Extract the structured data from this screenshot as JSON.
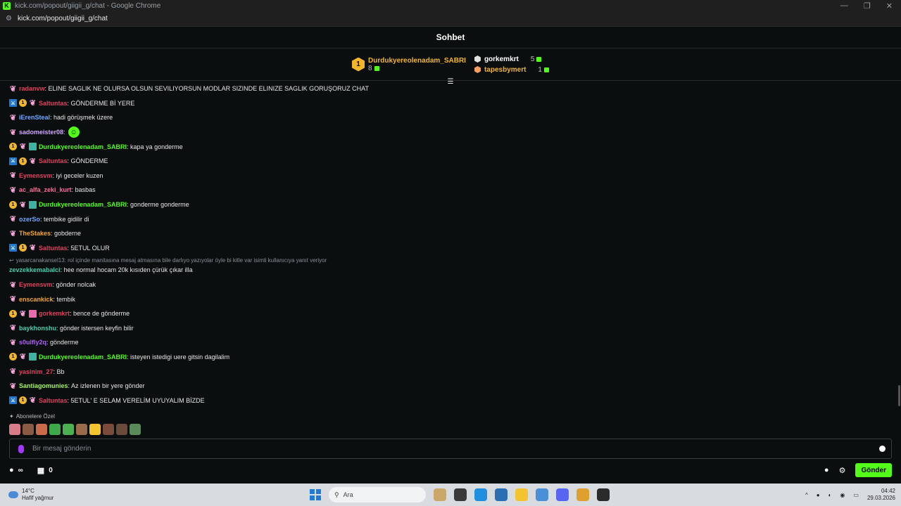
{
  "window": {
    "title": "kick.com/popout/giigii_g/chat - Google Chrome",
    "url": "kick.com/popout/giigii_g/chat",
    "controls": [
      "—",
      "❐",
      "✕"
    ]
  },
  "chat": {
    "header_title": "Sohbet",
    "leaderboard": {
      "first": {
        "rank": "1",
        "name": "Durdukyereolenadam_SABRI",
        "count": "8"
      },
      "others": [
        {
          "name": "gorkemkrt",
          "count": "5",
          "color": "#ffffff"
        },
        {
          "name": "tapesbymert",
          "count": "1",
          "color": "#f4b629"
        }
      ]
    },
    "messages": [
      {
        "badges": [
          "og"
        ],
        "user": "radanvw",
        "color": "#e3405f",
        "text": ": ELINE SAGLIK NE OLURSA OLSUN SEVILIYORSUN MODLAR SIZINDE ELINIZE SAGLIK GORUŞORUZ CHAT"
      },
      {
        "badges": [
          "mod",
          "sub",
          "og"
        ],
        "user": "Saltuntas",
        "color": "#e3405f",
        "text": ": GÖNDERME Bİ YERE"
      },
      {
        "badges": [
          "og"
        ],
        "user": "iErenSteal",
        "color": "#6fa8ff",
        "text": ": hadi görüşmek üzere"
      },
      {
        "badges": [
          "og"
        ],
        "user": "sadomeister08",
        "color": "#d0a6ff",
        "text": ":",
        "emote": true
      },
      {
        "badges": [
          "sub",
          "og",
          "gift"
        ],
        "user": "Durdukyereolenadam_SABRI",
        "color": "#53fc18",
        "text": ": kapa ya gonderme"
      },
      {
        "badges": [
          "mod",
          "sub",
          "og"
        ],
        "user": "Saltuntas",
        "color": "#e3405f",
        "text": ": GÖNDERME"
      },
      {
        "badges": [
          "og"
        ],
        "user": "Eymensvm",
        "color": "#e3405f",
        "text": ": iyi geceler kuzen"
      },
      {
        "badges": [
          "og"
        ],
        "user": "ac_alfa_zeki_kurt",
        "color": "#ff6b9a",
        "text": ": basbas"
      },
      {
        "badges": [
          "sub",
          "og",
          "gift"
        ],
        "user": "Durdukyereolenadam_SABRI",
        "color": "#53fc18",
        "text": ": gonderme gonderme"
      },
      {
        "badges": [
          "og"
        ],
        "user": "ozerSo",
        "color": "#6fa8ff",
        "text": ": tembike gidilir di"
      },
      {
        "badges": [
          "og"
        ],
        "user": "TheStakes",
        "color": "#f5a623",
        "text": ": gobderne"
      },
      {
        "badges": [
          "mod",
          "sub",
          "og"
        ],
        "user": "Saltuntas",
        "color": "#e3405f",
        "text": ": 5ETUL OLUR"
      },
      {
        "reply": "yasarcanakansel13: rol içinde manitasına mesaj atmasına bile darlıyo yazıyolar öyle bi kitle var isimli kullanıcıya yanıt veriyor",
        "badges": [],
        "user": "zevzekkemabalci",
        "color": "#3fd0b0",
        "text": ": hee normal hocam 20k kısıden çürük çıkar illa"
      },
      {
        "badges": [
          "og"
        ],
        "user": "Eymensvm",
        "color": "#e3405f",
        "text": ": gönder nolcak"
      },
      {
        "badges": [
          "og"
        ],
        "user": "enscankick",
        "color": "#f5a623",
        "text": ": tembik"
      },
      {
        "badges": [
          "sub",
          "og",
          "gifter"
        ],
        "user": "gorkemkrt",
        "color": "#e3405f",
        "text": ": bence de gönderme"
      },
      {
        "badges": [
          "og"
        ],
        "user": "baykhonshu",
        "color": "#3fd0b0",
        "text": ": gönder istersen keyfin bilir"
      },
      {
        "badges": [
          "og"
        ],
        "user": "s0ulfly2q",
        "color": "#b45cff",
        "text": ": gönderme"
      },
      {
        "badges": [
          "sub",
          "og",
          "gift"
        ],
        "user": "Durdukyereolenadam_SABRI",
        "color": "#53fc18",
        "text": ": isteyen istedigi uere gitsin dagilalim"
      },
      {
        "badges": [
          "og"
        ],
        "user": "yasinim_27",
        "color": "#e3405f",
        "text": ": Bb"
      },
      {
        "badges": [
          "og"
        ],
        "user": "Santiagomunies",
        "color": "#a6f25a",
        "text": ": Az izlenen bir yere gönder"
      },
      {
        "badges": [
          "mod",
          "sub",
          "og"
        ],
        "user": "Saltuntas",
        "color": "#e3405f",
        "text": ": 5ETUL' E SELAM VERELİM UYUYALIM BİZDE"
      }
    ],
    "quick_emotes_label": "Abonelere Özel",
    "quick_emote_colors": [
      "#d97c8a",
      "#8a5a44",
      "#c96a4a",
      "#3fa84a",
      "#4caf50",
      "#9a6a4a",
      "#f4c430",
      "#7a4a3a",
      "#6a4a3a",
      "#5a8a5a"
    ],
    "input_placeholder": "Bir mesaj gönderin",
    "bottom": {
      "infinity": "∞",
      "gift_count": "0",
      "send_label": "Gönder"
    }
  },
  "taskbar": {
    "weather_temp": "14°C",
    "weather_desc": "Hafif yağmur",
    "search_placeholder": "Ara",
    "time": "04:42",
    "date": "29.03.2026",
    "app_colors": [
      "#c9a86a",
      "#3a3a3a",
      "#1f8fe0",
      "#2a6fb0",
      "#f4c430",
      "#4a90d9",
      "#5865f2",
      "#e0a030",
      "#2a2a2a"
    ]
  }
}
